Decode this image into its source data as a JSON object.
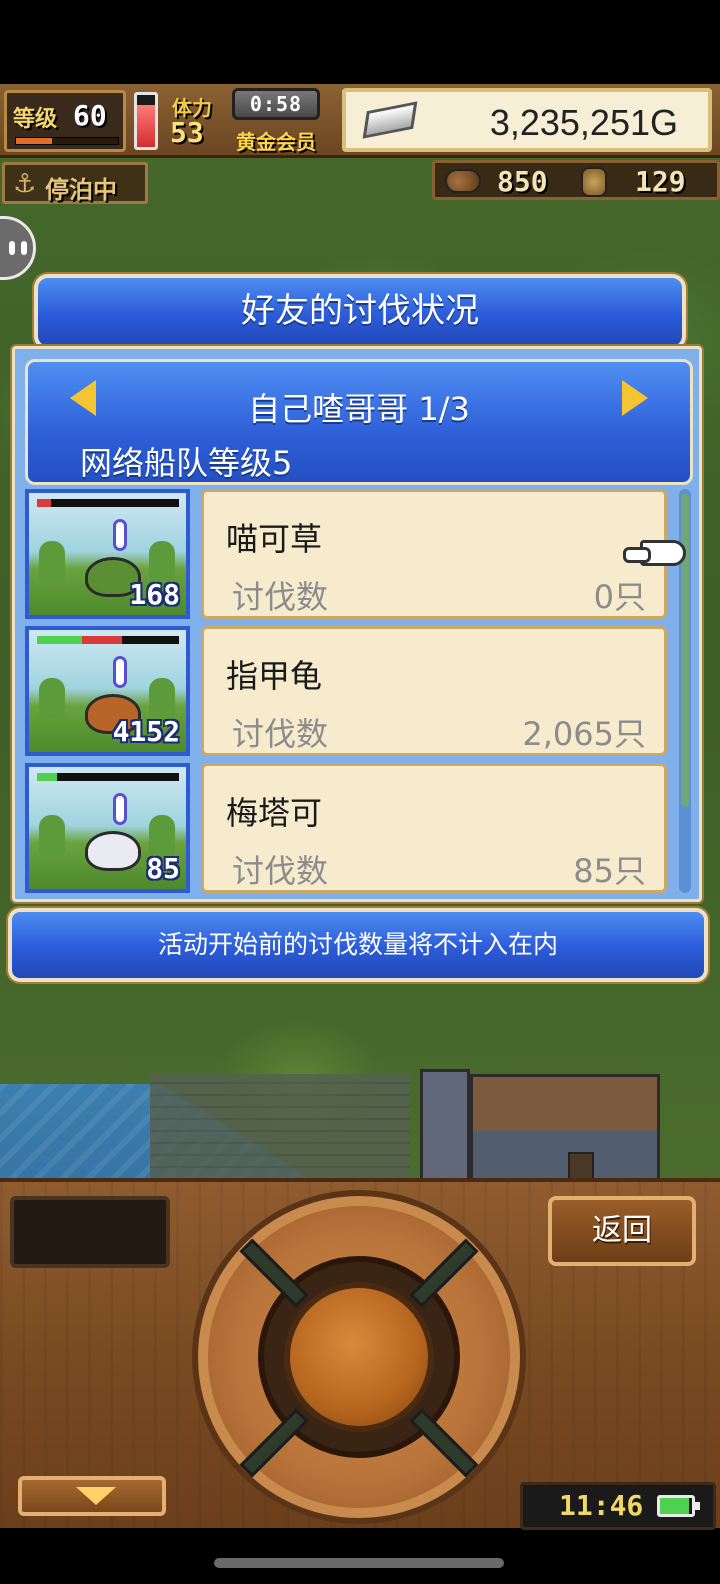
{
  "hud": {
    "level_label": "等级",
    "level_value": "60",
    "exp_fill_percent": 35,
    "stamina_vial_percent": 80,
    "stamina_label": "体力",
    "stamina_value": "53",
    "timer": "0:58",
    "member_label": "黄金会员",
    "gold": "3,235,251G",
    "status_label": "停泊中",
    "resources": {
      "wood": "850",
      "ore": "129"
    }
  },
  "dialog": {
    "title": "好友的讨伐状况",
    "friend_name": "自己喳哥哥 1/3",
    "fleet_level": "网络船队等级5",
    "kill_label": "讨伐数",
    "monsters": [
      {
        "name": "喵可草",
        "kill_count": "0只",
        "portrait_count": "168",
        "hp_fill": 0.1,
        "hp_color": "#d93a3a",
        "creature_color": "#5b8f33"
      },
      {
        "name": "指甲龟",
        "kill_count": "2,065只",
        "portrait_count": "4152",
        "hp_fill": 0.6,
        "hp_color": "#d93a3a",
        "creature_color": "#b8652a"
      },
      {
        "name": "梅塔可",
        "kill_count": "85只",
        "portrait_count": "85",
        "hp_fill": 0.14,
        "hp_color": "#4fd14f",
        "creature_color": "#eaeaf3"
      }
    ],
    "notice": "活动开始前的讨伐数量将不计入在内"
  },
  "controls": {
    "back_label": "返回",
    "clock": "11:46",
    "battery_percent": 90
  },
  "colors": {
    "dialog_blue": "#2c5bd8",
    "card_bg": "#f7ebcd",
    "gold_text": "#ffd54a"
  }
}
